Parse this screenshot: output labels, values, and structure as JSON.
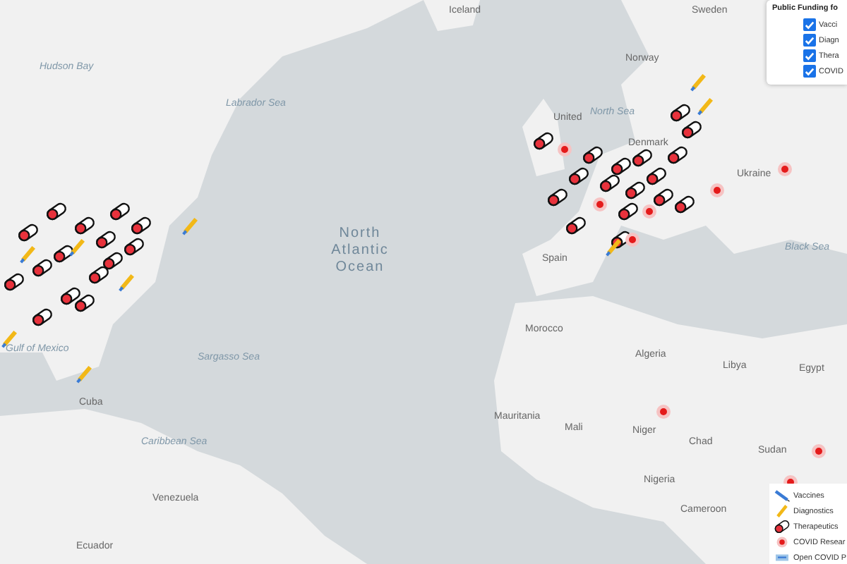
{
  "map": {
    "labels": [
      {
        "text": "Iceland",
        "kind": "country"
      },
      {
        "text": "Sweden",
        "kind": "country"
      },
      {
        "text": "Norway",
        "kind": "country"
      },
      {
        "text": "North Sea",
        "kind": "water"
      },
      {
        "text": "United",
        "kind": "country"
      },
      {
        "text": "Denmark",
        "kind": "country"
      },
      {
        "text": "Hudson Bay",
        "kind": "water"
      },
      {
        "text": "Labrador Sea",
        "kind": "water"
      },
      {
        "text": "North Atlantic Ocean",
        "kind": "ocean"
      },
      {
        "text": "Sargasso Sea",
        "kind": "water"
      },
      {
        "text": "Gulf of Mexico",
        "kind": "water"
      },
      {
        "text": "Cuba",
        "kind": "country"
      },
      {
        "text": "Caribbean Sea",
        "kind": "water"
      },
      {
        "text": "Venezuela",
        "kind": "country"
      },
      {
        "text": "Ecuador",
        "kind": "country"
      },
      {
        "text": "Spain",
        "kind": "country"
      },
      {
        "text": "Ukraine",
        "kind": "country"
      },
      {
        "text": "Black Sea",
        "kind": "water"
      },
      {
        "text": "Morocco",
        "kind": "country"
      },
      {
        "text": "Algeria",
        "kind": "country"
      },
      {
        "text": "Libya",
        "kind": "country"
      },
      {
        "text": "Egypt",
        "kind": "country"
      },
      {
        "text": "Mauritania",
        "kind": "country"
      },
      {
        "text": "Mali",
        "kind": "country"
      },
      {
        "text": "Niger",
        "kind": "country"
      },
      {
        "text": "Chad",
        "kind": "country"
      },
      {
        "text": "Sudan",
        "kind": "country"
      },
      {
        "text": "Nigeria",
        "kind": "country"
      },
      {
        "text": "Cameroon",
        "kind": "country"
      }
    ]
  },
  "filter_panel": {
    "title": "Public Funding fo",
    "options": [
      {
        "label": "Vacci",
        "checked": true
      },
      {
        "label": "Diagn",
        "checked": true
      },
      {
        "label": "Thera",
        "checked": true
      },
      {
        "label": "COVID",
        "checked": true
      }
    ]
  },
  "legend": {
    "items": [
      {
        "label": "Vaccines",
        "kind": "vaccine"
      },
      {
        "label": "Diagnostics",
        "kind": "diagnostic"
      },
      {
        "label": "Therapeutics",
        "kind": "therapeutic"
      },
      {
        "label": "COVID Resear",
        "kind": "research"
      },
      {
        "label": "Open COVID P",
        "kind": "open"
      }
    ]
  }
}
